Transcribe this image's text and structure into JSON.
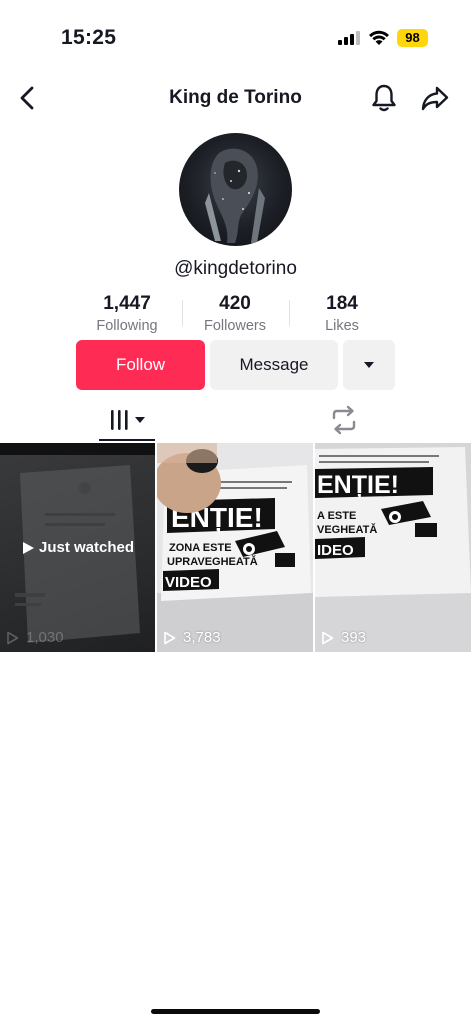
{
  "status_bar": {
    "time": "15:25",
    "battery": "98",
    "battery_color": "#ffd60a"
  },
  "header": {
    "title": "King de Torino"
  },
  "profile": {
    "username": "@kingdetorino"
  },
  "stats": [
    {
      "value": "1,447",
      "label": "Following"
    },
    {
      "value": "420",
      "label": "Followers"
    },
    {
      "value": "184",
      "label": "Likes"
    }
  ],
  "actions": {
    "follow": "Follow",
    "message": "Message"
  },
  "videos": [
    {
      "views": "1,030",
      "badge": "Just watched",
      "caption": ""
    },
    {
      "views": "3,783",
      "caption": "ENȚIE! ZONA ESTE UPRAVEGHEATĂ VIDEO"
    },
    {
      "views": "393",
      "caption": "ENȚIE! A ESTE VEGHEATĂ IDEO"
    }
  ],
  "colors": {
    "accent": "#fe2c55",
    "secondary_button": "#f1f1f2",
    "text": "#161823",
    "muted": "#75777e"
  },
  "icons": [
    "back-icon",
    "bell-icon",
    "share-icon",
    "dropdown-caret-icon",
    "grid-videos-icon",
    "repost-icon",
    "play-icon",
    "signal-icon",
    "wifi-icon"
  ]
}
